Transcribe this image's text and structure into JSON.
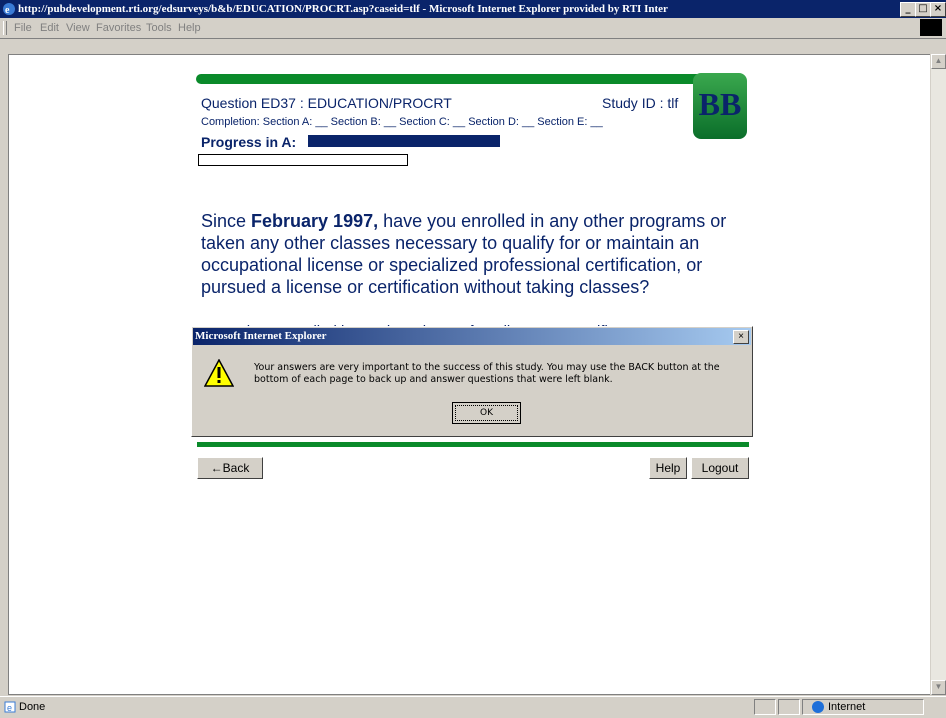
{
  "window": {
    "title": "http://pubdevelopment.rti.org/edsurveys/b&b/EDUCATION/PROCRT.asp?caseid=tlf - Microsoft Internet Explorer provided by RTI Inter",
    "minimize": "_",
    "maximize": "□",
    "close": "×"
  },
  "menu": [
    "File",
    "Edit",
    "View",
    "Favorites",
    "Tools",
    "Help"
  ],
  "page": {
    "question_id": "Question ED37 : EDUCATION/PROCRT",
    "study_id": "Study ID : tlf",
    "completion": "Completion:  Section A: __  Section B: __  Section C: __  Section D: __  Section E: __",
    "progress_label": "Progress in A:",
    "progress_value": 0.48,
    "logo_text": "BB",
    "question_pre": "Since ",
    "question_bold": "February 1997,",
    "question_post": " have you enrolled in any other programs or taken any other classes necessary to qualify for or maintain an occupational license or specialized professional certification, or pursued a license or certification without taking classes?",
    "option_peek": "○   Yes, have enrolled in or taken classes for a license or certificate",
    "back_button": "←Back",
    "help_button": "Help",
    "logout_button": "Logout"
  },
  "dialog": {
    "title": "Microsoft Internet Explorer",
    "close": "×",
    "message": "Your answers are very important to the success of this study.  You may use the BACK button at the bottom of each page to back up and answer questions that were left blank.",
    "ok": "OK"
  },
  "status": {
    "text": "Done",
    "zone": "Internet"
  },
  "colors": {
    "titlebar": "#0a246a",
    "green": "#0a8a2a",
    "navy": "#0a246a"
  }
}
